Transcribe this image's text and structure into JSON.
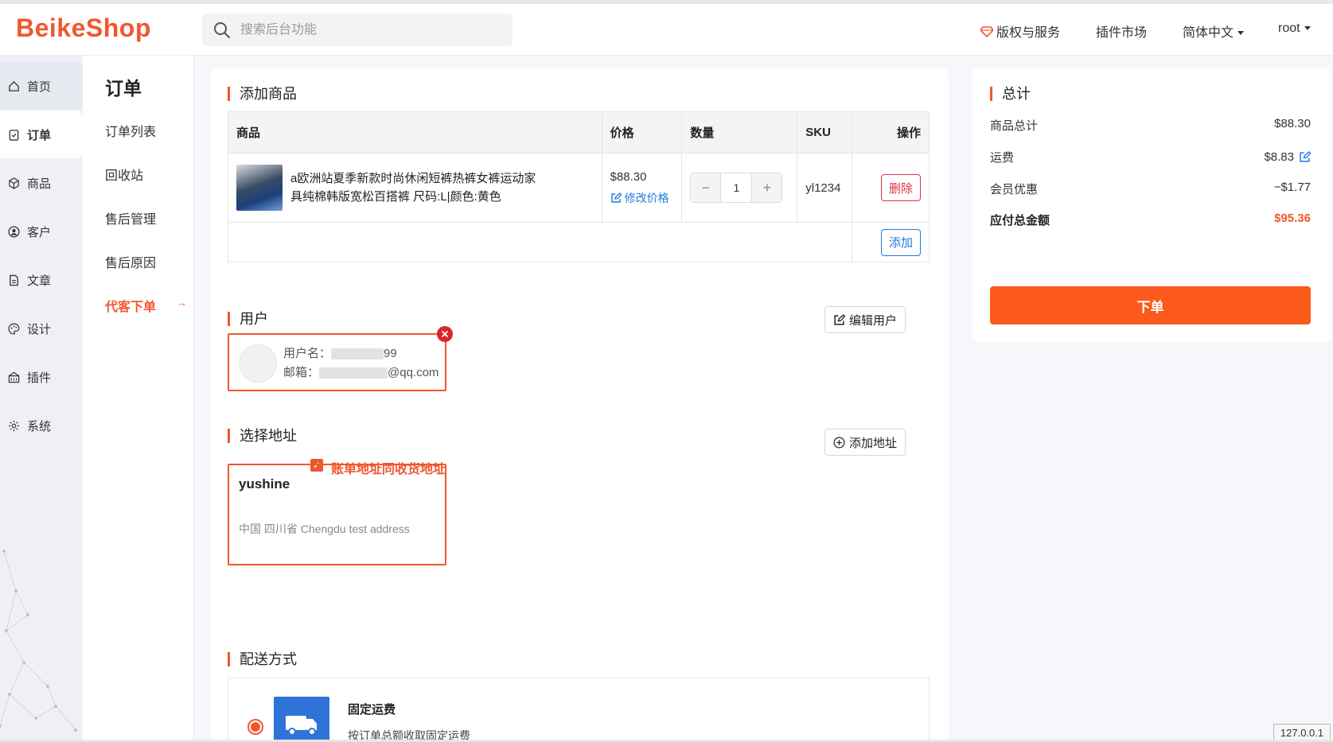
{
  "header": {
    "logo": "BeikeShop",
    "search_placeholder": "搜索后台功能",
    "nav": {
      "license": "版权与服务",
      "plugin_market": "插件市场",
      "language": "简体中文",
      "user": "root"
    }
  },
  "sidebar": {
    "items": [
      {
        "label": "首页",
        "icon": "home-icon"
      },
      {
        "label": "订单",
        "icon": "clipboard-icon"
      },
      {
        "label": "商品",
        "icon": "box-icon"
      },
      {
        "label": "客户",
        "icon": "user-circle-icon"
      },
      {
        "label": "文章",
        "icon": "document-icon"
      },
      {
        "label": "设计",
        "icon": "palette-icon"
      },
      {
        "label": "插件",
        "icon": "plugin-icon"
      },
      {
        "label": "系统",
        "icon": "gear-icon"
      }
    ]
  },
  "submenu": {
    "title": "订单",
    "items": [
      "订单列表",
      "回收站",
      "售后管理",
      "售后原因",
      "代客下单"
    ],
    "active_arrow": "→"
  },
  "products_section": {
    "title": "添加商品",
    "columns": [
      "商品",
      "价格",
      "数量",
      "SKU",
      "操作"
    ],
    "row": {
      "name": "a欧洲站夏季新款时尚休闲短裤热裤女裤运动家具纯棉韩版宽松百搭裤 尺码:L|颜色:黄色",
      "price": "$88.30",
      "edit_price": "修改价格",
      "quantity": "1",
      "sku": "yl1234",
      "delete": "删除"
    },
    "add_button": "添加"
  },
  "user_section": {
    "title": "用户",
    "edit_button": "编辑用户",
    "username_label": "用户名：",
    "username_value": "99",
    "email_label": "邮箱：",
    "email_value": "@qq.com"
  },
  "address_section": {
    "title": "选择地址",
    "same_billing": "账单地址同收货地址",
    "add_button": "添加地址",
    "address": {
      "name": "yushine",
      "detail": "中国 四川省 Chengdu test address"
    }
  },
  "shipping_section": {
    "title": "配送方式",
    "method_name": "固定运费",
    "method_desc": "按订单总额收取固定运费"
  },
  "summary": {
    "title": "总计",
    "rows": [
      {
        "label": "商品总计",
        "value": "$88.30"
      },
      {
        "label": "运费",
        "value": "$8.83"
      },
      {
        "label": "会员优惠",
        "value": "−$1.77"
      }
    ],
    "total_label": "应付总金额",
    "total_value": "$95.36",
    "submit": "下单"
  },
  "footer": {
    "ip": "127.0.0.1"
  },
  "colors": {
    "accent": "#f0572f",
    "primary_button": "#fb5a1a",
    "link": "#1f7ae0",
    "danger": "#dc3545"
  }
}
